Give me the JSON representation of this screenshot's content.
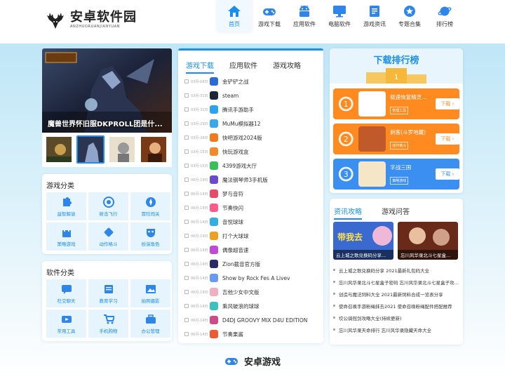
{
  "logo": {
    "name": "安卓软件园",
    "sub": "ANZHUORUANJIANYUAN"
  },
  "nav": [
    {
      "label": "首页",
      "icon": "home-icon"
    },
    {
      "label": "游戏下载",
      "icon": "gamepad-icon"
    },
    {
      "label": "应用软件",
      "icon": "android-icon"
    },
    {
      "label": "电脑软件",
      "icon": "monitor-icon"
    },
    {
      "label": "游戏资讯",
      "icon": "document-icon"
    },
    {
      "label": "专题合集",
      "icon": "star-icon"
    },
    {
      "label": "排行榜",
      "icon": "planet-icon"
    }
  ],
  "hero": {
    "title": "魔兽世界怀旧服DKPROLL团是什..."
  },
  "game_categories": {
    "title": "游戏分类",
    "items": [
      "益智解谜",
      "射击飞行",
      "冒险闯关",
      "策略游戏",
      "动作格斗",
      "扮演角色"
    ]
  },
  "app_categories": {
    "title": "软件分类",
    "items": [
      "社交聊天",
      "教育学习",
      "拍照摄影",
      "常用工具",
      "手机购物",
      "办公管理"
    ]
  },
  "mid_tabs": [
    "游戏下载",
    "应用软件",
    "游戏攻略"
  ],
  "list": [
    {
      "date": "03月-04日",
      "name": "金铲铲之战"
    },
    {
      "date": "03月-31日",
      "name": "steam"
    },
    {
      "date": "03月-31日",
      "name": "腾讯手游助手"
    },
    {
      "date": "03月-29日",
      "name": "MuMu模拟器12"
    },
    {
      "date": "03月-29日",
      "name": "快吧游戏2024版"
    },
    {
      "date": "03月-15日",
      "name": "快玩游戏盒"
    },
    {
      "date": "03月-15日",
      "name": "4399游戏大厅"
    },
    {
      "date": "06月-14日",
      "name": "魔法钢琴师3手机版"
    },
    {
      "date": "06月-14日",
      "name": "梦与音符"
    },
    {
      "date": "06月-14日",
      "name": "节奏快闪"
    },
    {
      "date": "06月-14日",
      "name": "音悦球球"
    },
    {
      "date": "06月-14日",
      "name": "打个大球球"
    },
    {
      "date": "06月-14日",
      "name": "偶像超音速"
    },
    {
      "date": "06月-14日",
      "name": "Zion截音官方版"
    },
    {
      "date": "06月-14日",
      "name": "Show by Rock Fes A Livev"
    },
    {
      "date": "06月-14日",
      "name": "吉他少女中文版"
    },
    {
      "date": "06月-14日",
      "name": "乘风破浪的球球"
    },
    {
      "date": "06月-14日",
      "name": "D4DJ GROOVY MIX D4U EDITION"
    },
    {
      "date": "06月-14日",
      "name": "节奏果酱"
    }
  ],
  "ranking": {
    "title": "下载排行榜",
    "items": [
      {
        "rank": "1",
        "name": "极速恢复精灵...",
        "tag": "管理工具",
        "dl": "下载"
      },
      {
        "rank": "2",
        "name": "刺客(斗罗地藏)",
        "tag": "动作格斗",
        "dl": "下载"
      },
      {
        "rank": "3",
        "name": "字战三国",
        "tag": "策略游戏",
        "dl": "下载"
      }
    ]
  },
  "news_tabs": [
    "资讯攻略",
    "游戏问答"
  ],
  "news_images": [
    {
      "caption": "云上城之歌兑换码分享..."
    },
    {
      "caption": "忘川风华录北斗七星盒..."
    }
  ],
  "news": [
    "云上城之歌兑换码分享 2021最新礼包码大全",
    "忘川风华录北斗七星盒子密码 忘川风华录北斗七星盒子攻...",
    "创造与魔法饲料大全 2021最新饲料合成一览表分享",
    "使命召唤手游粉绳抹去2021 使命召唤粉绳配件搭配推荐",
    "坎公骑冠剑攻略大全(持续更新)",
    "忘川风华录天命排行 忘川风华录隐藏天命大全"
  ],
  "footer": {
    "title": "安卓游戏"
  },
  "colors": {
    "accent": "#1a8ef0",
    "orange": "#ff8a1f",
    "blue": "#3a8ff0"
  }
}
